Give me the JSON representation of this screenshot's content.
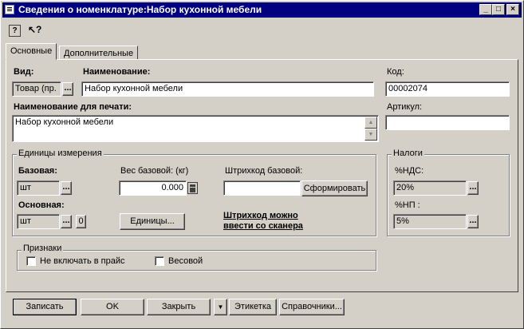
{
  "window": {
    "title": "Сведения о номенклатуре:Набор кухонной мебели",
    "controls": [
      "_",
      "□",
      "×"
    ]
  },
  "toolbar": {
    "help_icon": "?",
    "whatsthis_icon": "↖?"
  },
  "tabs": [
    {
      "label": "Основные",
      "active": true
    },
    {
      "label": "Дополнительные",
      "active": false
    }
  ],
  "main": {
    "vid_label": "Вид:",
    "vid_value": "Товар (пр.",
    "name_label": "Наименование:",
    "name_value": "Набор кухонной мебели",
    "code_label": "Код:",
    "code_value": "00002074",
    "print_name_label": "Наименование для печати:",
    "print_name_value": "Набор кухонной мебели",
    "article_label": "Артикул:",
    "article_value": ""
  },
  "units": {
    "legend": "Единицы измерения",
    "base_label": "Базовая:",
    "base_value": "шт",
    "weight_label": "Вес базовой: (кг)",
    "weight_value": "0.000",
    "barcode_label": "Штрихкод базовой:",
    "barcode_value": "",
    "generate_label": "Сформировать",
    "main_label": "Основная:",
    "main_value": "шт",
    "zero_label": "0",
    "units_button_label": "Единицы...",
    "scanner_hint_line1": "Штрихкод можно",
    "scanner_hint_line2": "ввести со сканера"
  },
  "taxes": {
    "legend": "Налоги",
    "vat_label": "%НДС:",
    "vat_value": "20%",
    "np_label": "%НП :",
    "np_value": "5%"
  },
  "features": {
    "legend": "Признаки",
    "exclude_price_label": "Не включать в прайс",
    "exclude_price_checked": false,
    "weighted_label": "Весовой",
    "weighted_checked": false
  },
  "buttons": {
    "save": "Записать",
    "ok": "OK",
    "close": "Закрыть",
    "label_dropdown": "▼",
    "label": "Этикетка",
    "references": "Справочники..."
  },
  "ellipsis": "..."
}
